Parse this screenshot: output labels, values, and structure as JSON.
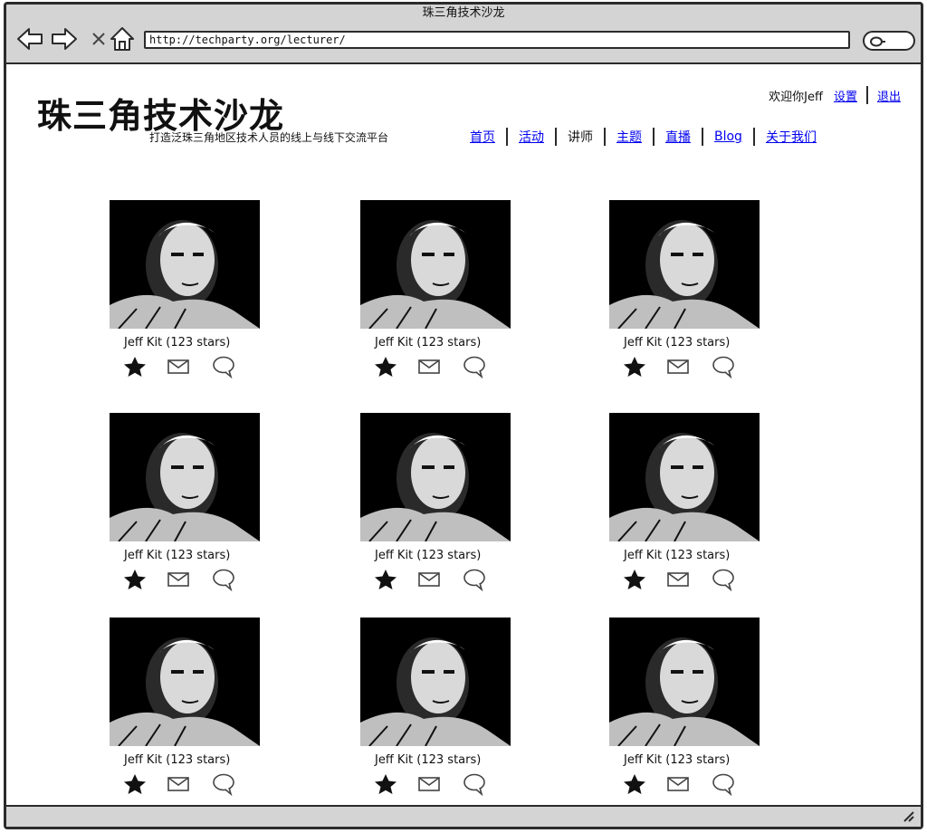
{
  "window": {
    "title": "珠三角技术沙龙"
  },
  "toolbar": {
    "url": "http://techparty.org/lecturer/",
    "icons": [
      "back-arrow-icon",
      "forward-arrow-icon",
      "stop-icon",
      "home-icon",
      "search-icon"
    ]
  },
  "site": {
    "title": "珠三角技术沙龙",
    "tagline": "打造泛珠三角地区技术人员的线上与线下交流平台"
  },
  "user": {
    "welcome": "欢迎你Jeff",
    "settings": "设置",
    "logout": "退出"
  },
  "nav": {
    "items": [
      {
        "label": "首页",
        "current": false
      },
      {
        "label": "活动",
        "current": false
      },
      {
        "label": "讲师",
        "current": true
      },
      {
        "label": "主题",
        "current": false
      },
      {
        "label": "直播",
        "current": false
      },
      {
        "label": "Blog",
        "current": false
      },
      {
        "label": "关于我们",
        "current": false
      }
    ]
  },
  "lecturers": [
    {
      "name": "Jeff Kit  (123 stars)"
    },
    {
      "name": "Jeff Kit  (123 stars)"
    },
    {
      "name": "Jeff Kit  (123 stars)"
    },
    {
      "name": "Jeff Kit  (123 stars)"
    },
    {
      "name": "Jeff Kit  (123 stars)"
    },
    {
      "name": "Jeff Kit  (123 stars)"
    },
    {
      "name": "Jeff Kit  (123 stars)"
    },
    {
      "name": "Jeff Kit  (123 stars)"
    },
    {
      "name": "Jeff Kit  (123 stars)"
    }
  ],
  "card_icons": [
    "star-icon",
    "mail-icon",
    "speech-bubble-icon"
  ]
}
